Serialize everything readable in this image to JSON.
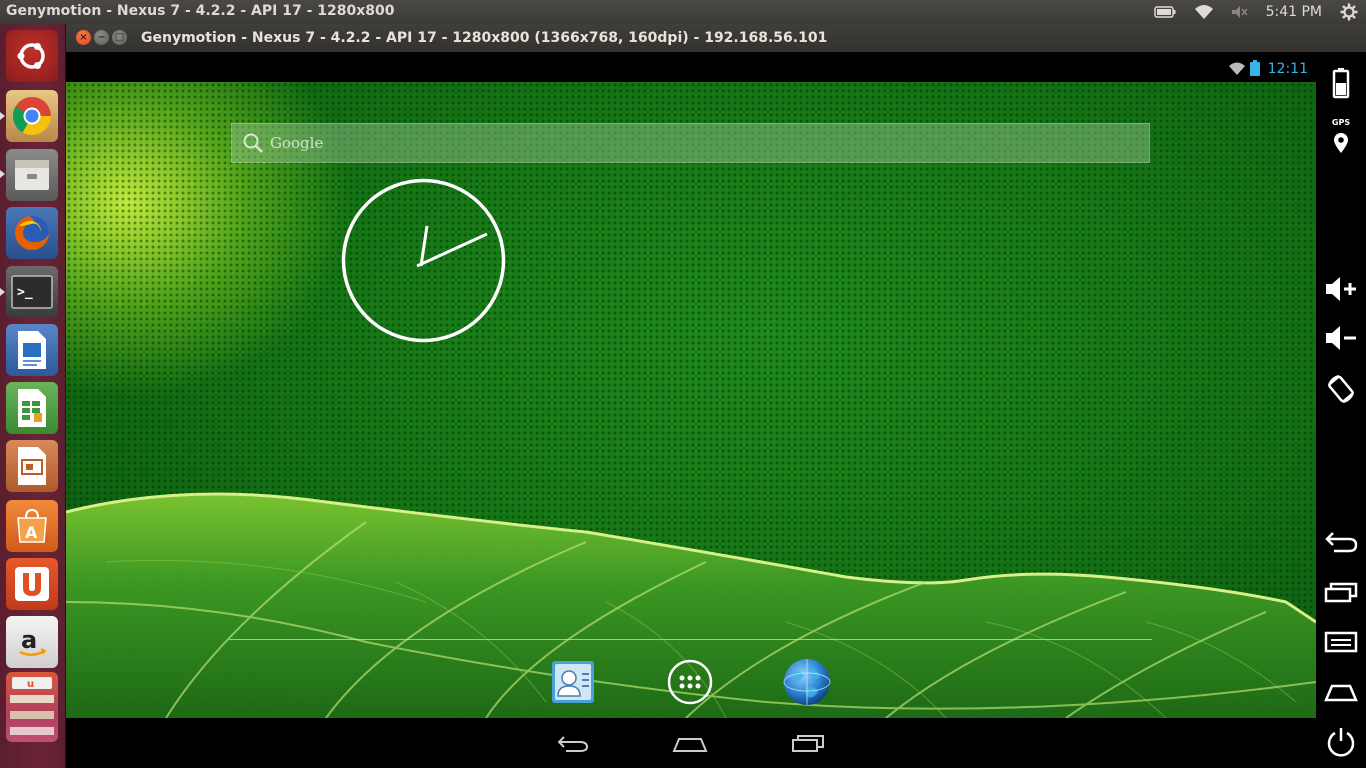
{
  "top_panel": {
    "title": "Genymotion - Nexus 7 - 4.2.2 - API 17 - 1280x800",
    "clock": "5:41 PM",
    "indicator_icons": [
      "battery-icon",
      "wifi-icon",
      "volume-muted-icon",
      "settings-gear-icon"
    ]
  },
  "launcher": {
    "items": [
      "ubuntu-dash",
      "chromium",
      "files",
      "firefox",
      "terminal",
      "libreoffice-writer",
      "libreoffice-calc",
      "libreoffice-impress",
      "ubuntu-software-center",
      "ubuntu-one",
      "amazon",
      "more-apps"
    ]
  },
  "window": {
    "title": "Genymotion - Nexus 7 - 4.2.2 - API 17 - 1280x800 (1366x768, 160dpi) - 192.168.56.101"
  },
  "android": {
    "status_time": "12:11",
    "search_placeholder": "Google",
    "dock": [
      "contacts",
      "all-apps",
      "browser"
    ],
    "nav_buttons": [
      "back",
      "home",
      "recent-apps"
    ]
  },
  "side_toolbar": {
    "gps_label": "GPS",
    "buttons": [
      "battery",
      "gps",
      "volume-up",
      "volume-down",
      "rotate",
      "back",
      "recent-apps",
      "menu",
      "home",
      "power"
    ]
  },
  "colors": {
    "status_blue": "#33b5e5",
    "launcher_bg": "#6a2437",
    "panel_bg": "#3c3b37",
    "wallpaper_green": "#1a7f19"
  }
}
